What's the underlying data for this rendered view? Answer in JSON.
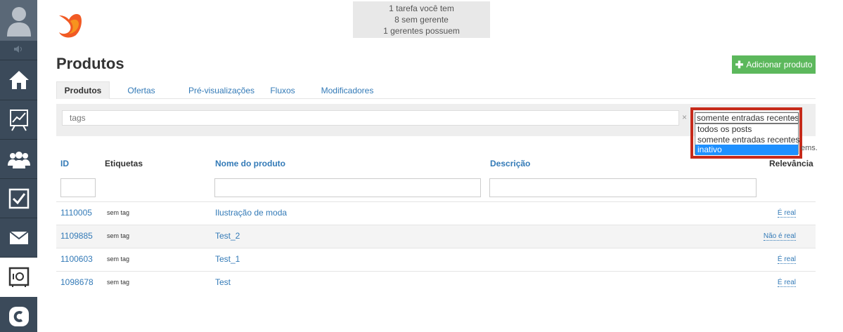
{
  "sidebar": {
    "items": [
      {
        "icon": "home-icon"
      },
      {
        "icon": "chart-icon"
      },
      {
        "icon": "users-icon"
      },
      {
        "icon": "tasks-icon"
      },
      {
        "icon": "mail-icon"
      },
      {
        "icon": "products-icon",
        "active": true
      },
      {
        "icon": "c-logo-icon"
      }
    ]
  },
  "notification": {
    "line1": "1 tarefa você tem",
    "line2": "8 sem gerente",
    "line3": "1 gerentes possuem"
  },
  "page": {
    "title": "Produtos",
    "add_button": "Adicionar produto"
  },
  "tabs": [
    "Produtos",
    "Ofertas",
    "Pré-visualizações",
    "Fluxos",
    "Modificadores"
  ],
  "filters": {
    "tags_placeholder": "tags",
    "clear": "×",
    "status_selected": "somente entradas recentes",
    "status_options": [
      "todos os posts",
      "somente entradas recentes",
      "inativo"
    ],
    "highlighted_option": "inativo",
    "items_suffix": "ems."
  },
  "table": {
    "headers": {
      "id": "ID",
      "tags": "Etiquetas",
      "name": "Nome do produto",
      "description": "Descrição",
      "relevance": "Relevância"
    },
    "rows": [
      {
        "id": "1110005",
        "tag": "sem tag",
        "name": "Ilustração de moda",
        "relevance": "É real"
      },
      {
        "id": "1109885",
        "tag": "sem tag",
        "name": "Test_2",
        "relevance": "Não é real"
      },
      {
        "id": "1100603",
        "tag": "sem tag",
        "name": "Test_1",
        "relevance": "É real"
      },
      {
        "id": "1098678",
        "tag": "sem tag",
        "name": "Test",
        "relevance": "É real"
      }
    ]
  },
  "colors": {
    "sidebar": "#3b4a5a",
    "link": "#337ab7",
    "add_button": "#5cb85c",
    "highlight_border": "#c62a1a",
    "selected_option": "#1e90ff"
  }
}
